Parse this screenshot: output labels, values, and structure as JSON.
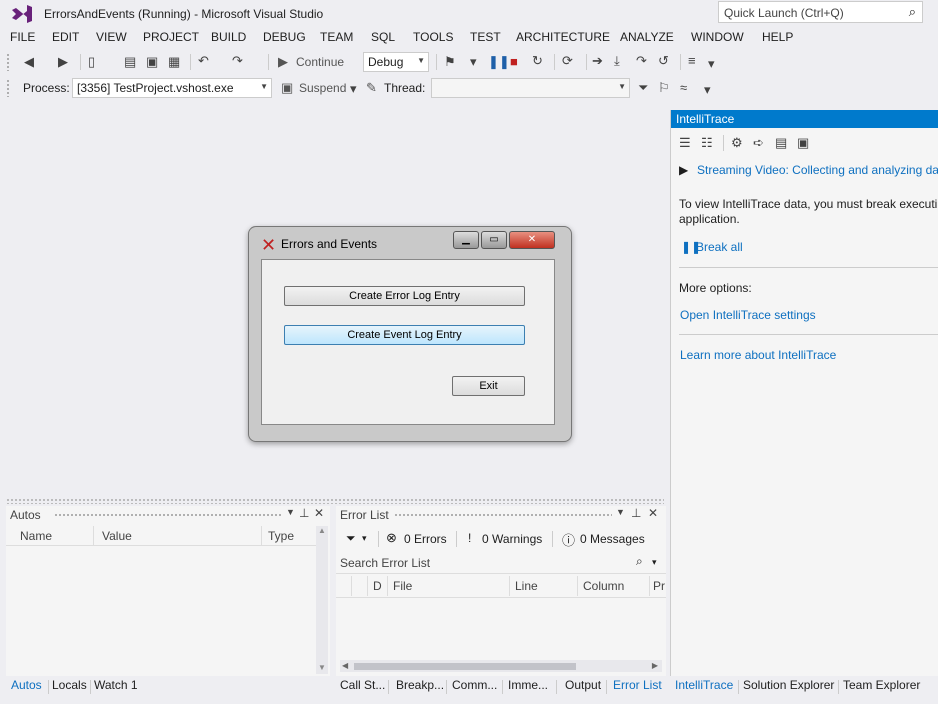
{
  "titlebar": {
    "title": "ErrorsAndEvents (Running) - Microsoft Visual Studio",
    "quick_launch_placeholder": "Quick Launch (Ctrl+Q)"
  },
  "menu": [
    "FILE",
    "EDIT",
    "VIEW",
    "PROJECT",
    "BUILD",
    "DEBUG",
    "TEAM",
    "SQL",
    "TOOLS",
    "TEST",
    "ARCHITECTURE",
    "ANALYZE",
    "WINDOW",
    "HELP"
  ],
  "toolbar1": {
    "continue_label": "Continue",
    "config_value": "Debug"
  },
  "toolbar2": {
    "process_label": "Process:",
    "process_value": "[3356] TestProject.vshost.exe",
    "suspend_label": "Suspend",
    "thread_label": "Thread:",
    "thread_value": ""
  },
  "app_window": {
    "title": "Errors and Events",
    "buttons": {
      "create_error": "Create Error Log Entry",
      "create_event": "Create Event Log Entry",
      "exit": "Exit"
    }
  },
  "autos": {
    "title": "Autos",
    "columns": [
      "Name",
      "Value",
      "Type"
    ]
  },
  "error_list": {
    "title": "Error List",
    "errors": "0 Errors",
    "warnings": "0 Warnings",
    "messages": "0 Messages",
    "search_placeholder": "Search Error List",
    "columns": [
      "D",
      "File",
      "Line",
      "Column",
      "Pr"
    ]
  },
  "bottom_tabs_left": [
    "Autos",
    "Locals",
    "Watch 1"
  ],
  "bottom_tabs_mid": [
    "Call St...",
    "Breakp...",
    "Comm...",
    "Imme...",
    "Output",
    "Error List"
  ],
  "bottom_tabs_right": [
    "IntelliTrace",
    "Solution Explorer",
    "Team Explorer"
  ],
  "intellitrace": {
    "title": "IntelliTrace",
    "video_link": "Streaming Video: Collecting and analyzing da",
    "info_line1": "To view IntelliTrace data, you must break executi",
    "info_line2": "application.",
    "break_all": "Break all",
    "more_options": "More options:",
    "settings_link": "Open IntelliTrace settings",
    "learn_link": "Learn more about IntelliTrace"
  },
  "colors": {
    "accent": "#007acc",
    "link": "#0e70c0",
    "stop": "#c02020"
  }
}
